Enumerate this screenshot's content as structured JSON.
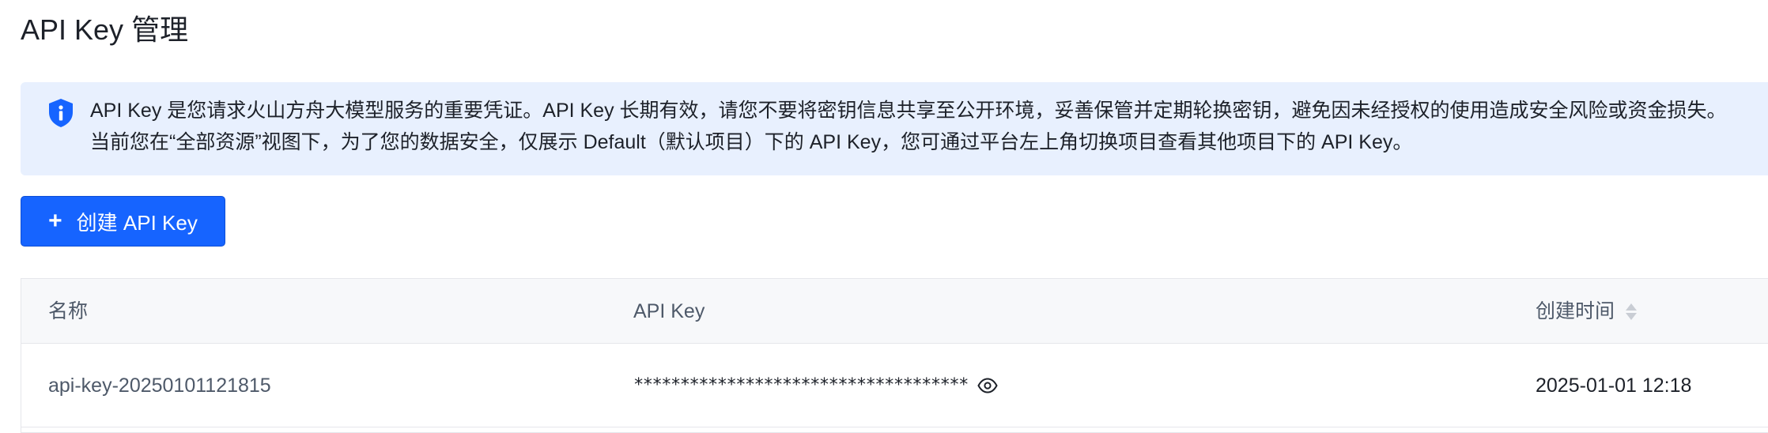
{
  "page": {
    "title": "API Key 管理"
  },
  "notice": {
    "icon": "shield-info-icon",
    "line1": "API Key 是您请求火山方舟大模型服务的重要凭证。API Key 长期有效，请您不要将密钥信息共享至公开环境，妥善保管并定期轮换密钥，避免因未经授权的使用造成安全风险或资金损失。",
    "line2": "当前您在“全部资源”视图下，为了您的数据安全，仅展示 Default（默认项目）下的 API Key，您可通过平台左上角切换项目查看其他项目下的 API Key。"
  },
  "toolbar": {
    "create_icon": "plus-icon",
    "create_label": "创建 API Key"
  },
  "table": {
    "columns": [
      "名称",
      "API Key",
      "创建时间"
    ],
    "rows": [
      {
        "name": "api-key-20250101121815",
        "api_key": "************************************",
        "created_at": "2025-01-01 12:18"
      }
    ]
  },
  "colors": {
    "primary": "#1664ff",
    "notice_bg": "#e8f0fe",
    "header_bg": "#f7f8fa",
    "border": "#e5e6eb"
  }
}
